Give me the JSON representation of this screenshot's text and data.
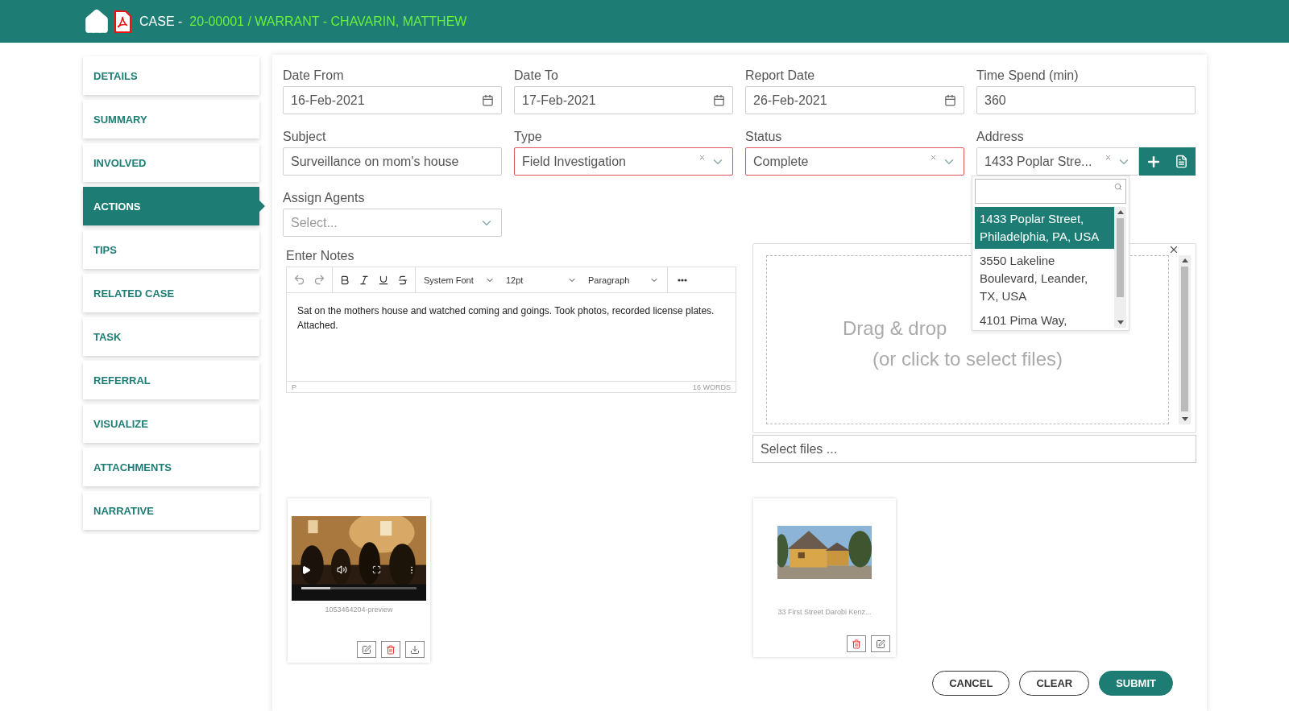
{
  "header": {
    "case_label": "CASE -",
    "case_title": "20-00001 / WARRANT - CHAVARIN, MATTHEW"
  },
  "sidebar": {
    "items": [
      {
        "label": "DETAILS",
        "selected": false
      },
      {
        "label": "SUMMARY",
        "selected": false
      },
      {
        "label": "INVOLVED",
        "selected": false
      },
      {
        "label": "ACTIONS",
        "selected": true
      },
      {
        "label": "TIPS",
        "selected": false
      },
      {
        "label": "RELATED CASE",
        "selected": false
      },
      {
        "label": "TASK",
        "selected": false
      },
      {
        "label": "REFERRAL",
        "selected": false
      },
      {
        "label": "VISUALIZE",
        "selected": false
      },
      {
        "label": "ATTACHMENTS",
        "selected": false
      },
      {
        "label": "NARRATIVE",
        "selected": false
      }
    ]
  },
  "fields": [
    {
      "kind": "date",
      "label": "Date From",
      "value": "16-Feb-2021",
      "invalid": false
    },
    {
      "kind": "date",
      "label": "Date To",
      "value": "17-Feb-2021",
      "invalid": false
    },
    {
      "kind": "date",
      "label": "Report Date",
      "value": "26-Feb-2021",
      "invalid": false
    },
    {
      "kind": "text",
      "label": "Time Spend (min)",
      "value": "360",
      "invalid": false
    },
    {
      "kind": "text",
      "label": "Subject",
      "value": "Surveillance on mom's house",
      "invalid": false
    },
    {
      "kind": "select",
      "label": "Type",
      "value": "Field Investigation",
      "invalid": true
    },
    {
      "kind": "select",
      "label": "Status",
      "value": "Complete",
      "invalid": true
    },
    {
      "kind": "address",
      "label": "Address",
      "value": "1433 Poplar Stre...",
      "invalid": false
    }
  ],
  "address_dropdown": {
    "options": [
      {
        "label": "1433 Poplar Street, Philadelphia, PA, USA",
        "selected": true
      },
      {
        "label": "3550 Lakeline Boulevard, Leander, TX, USA",
        "selected": false
      },
      {
        "label": "4101 Pima Way,",
        "selected": false
      }
    ]
  },
  "assign_agents": {
    "label": "Assign Agents",
    "placeholder": "Select..."
  },
  "notes": {
    "label": "Enter Notes",
    "font": "System Font",
    "size": "12pt",
    "block": "Paragraph",
    "text": "Sat on the mothers house and watched coming and goings. Took photos, recorded license plates. Attached.",
    "path": "P",
    "word_count": "16 WORDS"
  },
  "dropzone": {
    "lines": [
      "Drag & drop",
      "(or click to select files)"
    ],
    "placeholder": "Select files ..."
  },
  "attachments": [
    {
      "kind": "video",
      "caption": "1053464204-preview",
      "level": 0.25,
      "actions": [
        {
          "kind": "edit"
        },
        {
          "kind": "delete"
        },
        {
          "kind": "download"
        }
      ]
    },
    {
      "caption": "33 First Street Darobi Kenz...",
      "actions": [
        {
          "kind": "delete"
        },
        {
          "kind": "edit"
        }
      ]
    }
  ],
  "buttons": [
    {
      "label": "CANCEL",
      "kind": "outline"
    },
    {
      "label": "CLEAR",
      "kind": "outline"
    },
    {
      "label": "SUBMIT",
      "kind": "primary"
    }
  ]
}
